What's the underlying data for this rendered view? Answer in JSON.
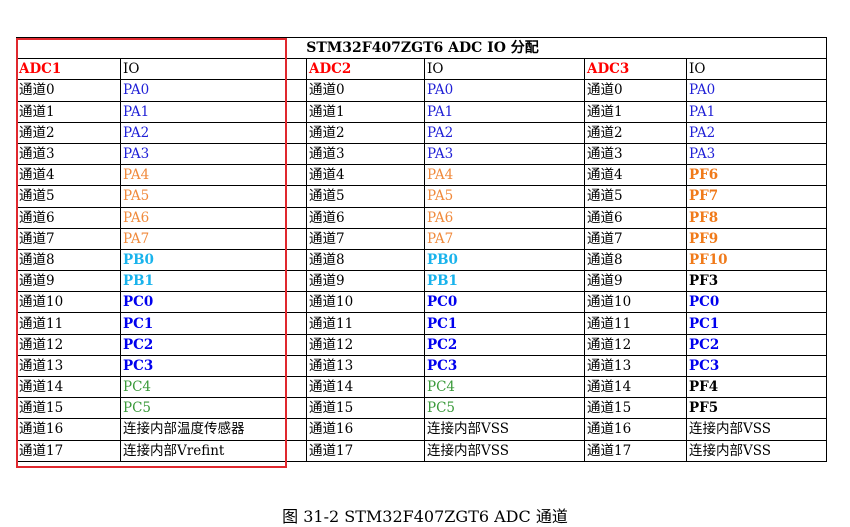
{
  "table": {
    "title": "STM32F407ZGT6  ADC IO 分配",
    "headers": [
      "ADC1",
      "IO",
      "ADC2",
      "IO",
      "ADC3",
      "IO"
    ],
    "rows": [
      {
        "ch": "通道0",
        "adc1": "PA0",
        "adc2": "PA0",
        "adc3": "PA0",
        "c1": "blue",
        "c2": "blue",
        "c3": "blue"
      },
      {
        "ch": "通道1",
        "adc1": "PA1",
        "adc2": "PA1",
        "adc3": "PA1",
        "c1": "blue",
        "c2": "blue",
        "c3": "blue"
      },
      {
        "ch": "通道2",
        "adc1": "PA2",
        "adc2": "PA2",
        "adc3": "PA2",
        "c1": "blue",
        "c2": "blue",
        "c3": "blue"
      },
      {
        "ch": "通道3",
        "adc1": "PA3",
        "adc2": "PA3",
        "adc3": "PA3",
        "c1": "blue",
        "c2": "blue",
        "c3": "blue"
      },
      {
        "ch": "通道4",
        "adc1": "PA4",
        "adc2": "PA4",
        "adc3": "PF6",
        "c1": "orange",
        "c2": "orange",
        "c3": "orange-b"
      },
      {
        "ch": "通道5",
        "adc1": "PA5",
        "adc2": "PA5",
        "adc3": "PF7",
        "c1": "orange",
        "c2": "orange",
        "c3": "orange-b"
      },
      {
        "ch": "通道6",
        "adc1": "PA6",
        "adc2": "PA6",
        "adc3": "PF8",
        "c1": "orange",
        "c2": "orange",
        "c3": "orange-b"
      },
      {
        "ch": "通道7",
        "adc1": "PA7",
        "adc2": "PA7",
        "adc3": "PF9",
        "c1": "orange",
        "c2": "orange",
        "c3": "orange-b"
      },
      {
        "ch": "通道8",
        "adc1": "PB0",
        "adc2": "PB0",
        "adc3": "PF10",
        "c1": "cyan",
        "c2": "cyan",
        "c3": "orange-b"
      },
      {
        "ch": "通道9",
        "adc1": "PB1",
        "adc2": "PB1",
        "adc3": "PF3",
        "c1": "cyan",
        "c2": "cyan",
        "c3": "black-b"
      },
      {
        "ch": "通道10",
        "adc1": "PC0",
        "adc2": "PC0",
        "adc3": "PC0",
        "c1": "navy",
        "c2": "navy",
        "c3": "navy"
      },
      {
        "ch": "通道11",
        "adc1": "PC1",
        "adc2": "PC1",
        "adc3": "PC1",
        "c1": "navy",
        "c2": "navy",
        "c3": "navy"
      },
      {
        "ch": "通道12",
        "adc1": "PC2",
        "adc2": "PC2",
        "adc3": "PC2",
        "c1": "navy",
        "c2": "navy",
        "c3": "navy"
      },
      {
        "ch": "通道13",
        "adc1": "PC3",
        "adc2": "PC3",
        "adc3": "PC3",
        "c1": "navy",
        "c2": "navy",
        "c3": "navy"
      },
      {
        "ch": "通道14",
        "adc1": "PC4",
        "adc2": "PC4",
        "adc3": "PF4",
        "c1": "green",
        "c2": "green",
        "c3": "black-b"
      },
      {
        "ch": "通道15",
        "adc1": "PC5",
        "adc2": "PC5",
        "adc3": "PF5",
        "c1": "green",
        "c2": "green",
        "c3": "black-b"
      },
      {
        "ch": "通道16",
        "adc1": "连接内部温度传感器",
        "adc2": "连接内部VSS",
        "adc3": "连接内部VSS",
        "c1": "plain",
        "c2": "plain",
        "c3": "plain"
      },
      {
        "ch": "通道17",
        "adc1": "连接内部Vrefint",
        "adc2": "连接内部VSS",
        "adc3": "连接内部VSS",
        "c1": "plain",
        "c2": "plain",
        "c3": "plain"
      }
    ],
    "colors": {
      "header_adc": "#ff0000",
      "highlight_box": "#e0282e",
      "blue": "#1f1fd6",
      "orange": "#f08a3c",
      "cyan": "#19b3ec",
      "navy": "#0000ee",
      "green": "#3a9a3a"
    }
  },
  "caption": "图 31-2 STM32F407ZGT6 ADC 通道"
}
